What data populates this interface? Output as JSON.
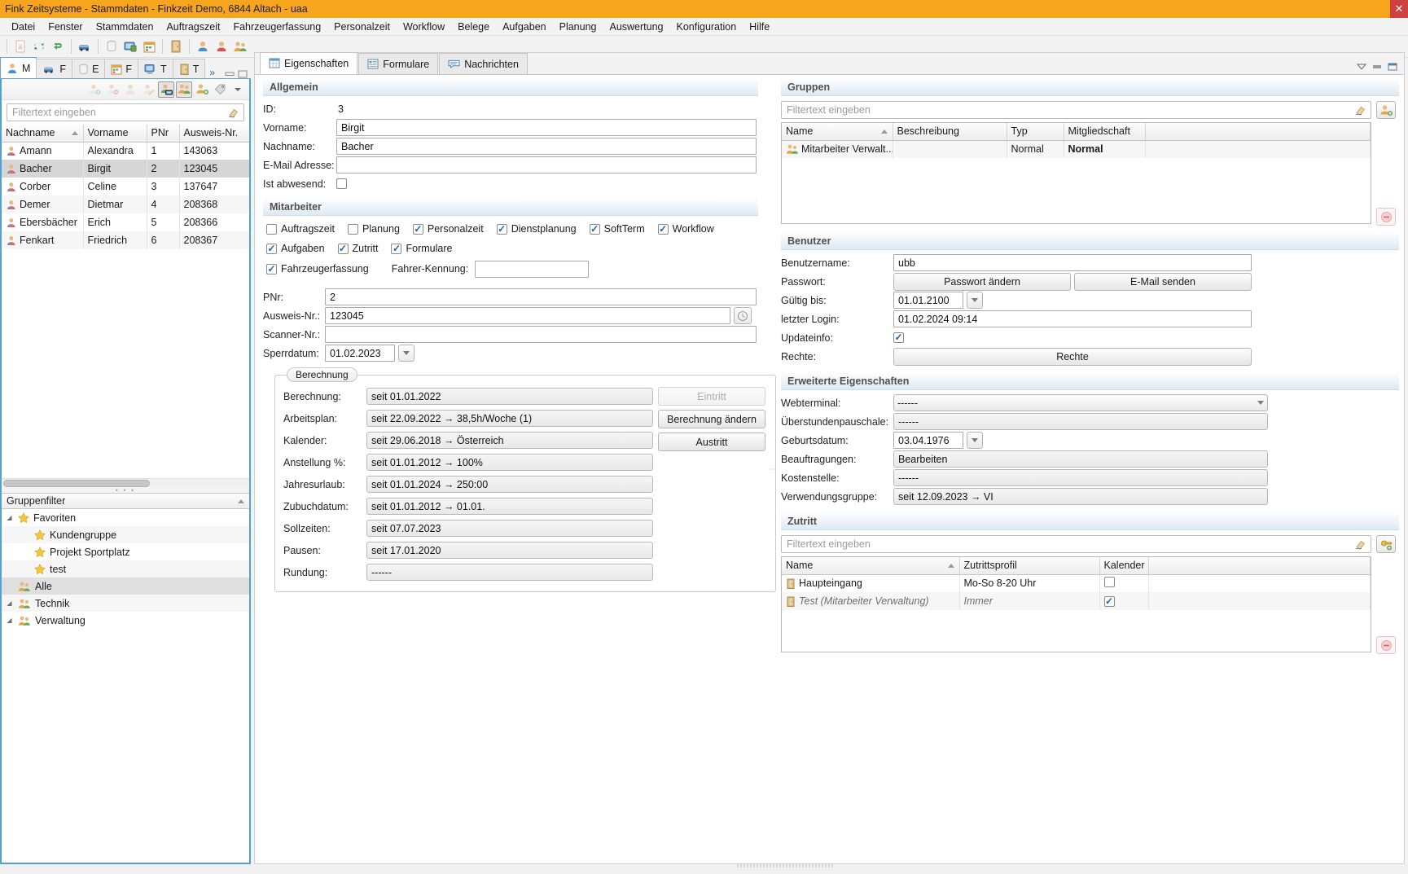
{
  "window": {
    "title": "Fink Zeitsysteme - Stammdaten - Finkzeit Demo, 6844 Altach - uaa",
    "close_label": "✕"
  },
  "menubar": {
    "items": [
      "Datei",
      "Fenster",
      "Stammdaten",
      "Auftragszeit",
      "Fahrzeugerfassung",
      "Personalzeit",
      "Workflow",
      "Belege",
      "Aufgaben",
      "Planung",
      "Auswertung",
      "Konfiguration",
      "Hilfe"
    ]
  },
  "toolbar": {
    "icons": [
      "save-icon",
      "pdf-icon",
      "refresh-icon",
      "undo-icon",
      "car-icon",
      "database-icon",
      "terminal-icon",
      "calendar-icon",
      "door-icon",
      "person-blue-icon",
      "person-red-icon",
      "person-group-icon"
    ]
  },
  "left": {
    "tabs": [
      {
        "label": "M",
        "icon": "person-blue-icon",
        "active": true
      },
      {
        "label": "F",
        "icon": "car-icon",
        "active": false
      },
      {
        "label": "E",
        "icon": "database-icon",
        "active": false
      },
      {
        "label": "F",
        "icon": "calendar-icon",
        "active": false
      },
      {
        "label": "T",
        "icon": "terminal-icon",
        "active": false
      },
      {
        "label": "T",
        "icon": "door-icon",
        "active": false
      }
    ],
    "tabs_more": "»",
    "panel_buttons": [
      {
        "name": "add-person-icon",
        "pressed": false
      },
      {
        "name": "remove-person-icon",
        "pressed": false
      },
      {
        "name": "person-red-icon",
        "pressed": false
      },
      {
        "name": "edit-person-icon",
        "pressed": false
      },
      {
        "name": "person-card-icon",
        "pressed": true
      },
      {
        "name": "person-group-green-icon",
        "pressed": true
      },
      {
        "name": "person-add-green-icon",
        "pressed": false
      },
      {
        "name": "tag-icon",
        "pressed": false
      }
    ],
    "filter_placeholder": "Filtertext eingeben",
    "filter_value": "",
    "table": {
      "columns": [
        "Nachname",
        "Vorname",
        "PNr",
        "Ausweis-Nr."
      ],
      "sorted_column": 0,
      "rows": [
        {
          "nachname": "Amann",
          "vorname": "Alexandra",
          "pnr": "1",
          "ausweis": "143063",
          "selected": false
        },
        {
          "nachname": "Bacher",
          "vorname": "Birgit",
          "pnr": "2",
          "ausweis": "123045",
          "selected": true
        },
        {
          "nachname": "Corber",
          "vorname": "Celine",
          "pnr": "3",
          "ausweis": "137647",
          "selected": false
        },
        {
          "nachname": "Demer",
          "vorname": "Dietmar",
          "pnr": "4",
          "ausweis": "208368",
          "selected": false
        },
        {
          "nachname": "Ebersbächer",
          "vorname": "Erich",
          "pnr": "5",
          "ausweis": "208366",
          "selected": false
        },
        {
          "nachname": "Fenkart",
          "vorname": "Friedrich",
          "pnr": "6",
          "ausweis": "208367",
          "selected": false
        }
      ]
    },
    "groupfilter": {
      "title": "Gruppenfilter",
      "nodes": [
        {
          "label": "Favoriten",
          "icon": "star-icon",
          "indent": 0,
          "expandable": true,
          "selected": false
        },
        {
          "label": "Kundengruppe",
          "icon": "star-icon",
          "indent": 1,
          "expandable": false,
          "selected": false
        },
        {
          "label": "Projekt Sportplatz",
          "icon": "star-icon",
          "indent": 1,
          "expandable": false,
          "selected": false
        },
        {
          "label": "test",
          "icon": "star-icon",
          "indent": 1,
          "expandable": false,
          "selected": false
        },
        {
          "label": "Alle",
          "icon": "person-group-icon",
          "indent": 0,
          "expandable": false,
          "selected": true
        },
        {
          "label": "Technik",
          "icon": "person-group-icon",
          "indent": 0,
          "expandable": true,
          "selected": false
        },
        {
          "label": "Verwaltung",
          "icon": "person-group-icon",
          "indent": 0,
          "expandable": true,
          "selected": false
        }
      ]
    }
  },
  "content": {
    "tabs": [
      {
        "label": "Eigenschaften",
        "icon": "table-icon",
        "active": true
      },
      {
        "label": "Formulare",
        "icon": "form-icon",
        "active": false
      },
      {
        "label": "Nachrichten",
        "icon": "message-icon",
        "active": false
      }
    ]
  },
  "allgemein": {
    "title": "Allgemein",
    "id_label": "ID:",
    "id_value": "3",
    "vorname_label": "Vorname:",
    "vorname_value": "Birgit",
    "nachname_label": "Nachname:",
    "nachname_value": "Bacher",
    "email_label": "E-Mail Adresse:",
    "email_value": "",
    "abwesend_label": "Ist abwesend:",
    "abwesend_checked": false
  },
  "mitarbeiter": {
    "title": "Mitarbeiter",
    "checkboxes_row1": [
      {
        "label": "Auftragszeit",
        "checked": false
      },
      {
        "label": "Planung",
        "checked": false
      },
      {
        "label": "Personalzeit",
        "checked": true
      },
      {
        "label": "Dienstplanung",
        "checked": true
      },
      {
        "label": "SoftTerm",
        "checked": true
      },
      {
        "label": "Workflow",
        "checked": true
      }
    ],
    "checkboxes_row2": [
      {
        "label": "Aufgaben",
        "checked": true
      },
      {
        "label": "Zutritt",
        "checked": true
      },
      {
        "label": "Formulare",
        "checked": true
      }
    ],
    "fahrzeug_label": "Fahrzeugerfassung",
    "fahrzeug_checked": true,
    "fahrer_label": "Fahrer-Kennung:",
    "fahrer_value": "",
    "pnr_label": "PNr:",
    "pnr_value": "2",
    "ausweis_label": "Ausweis-Nr.:",
    "ausweis_value": "123045",
    "scanner_label": "Scanner-Nr.:",
    "scanner_value": "",
    "sperrdatum_label": "Sperrdatum:",
    "sperrdatum_value": "01.02.2023"
  },
  "berechnung": {
    "legend": "Berechnung",
    "rows": [
      {
        "label": "Berechnung:",
        "value": "seit 01.01.2022"
      },
      {
        "label": "Arbeitsplan:",
        "value": "seit 22.09.2022 → 38,5h/Woche (1)"
      },
      {
        "label": "Kalender:",
        "value": "seit 29.06.2018 → Österreich"
      },
      {
        "label": "Anstellung %:",
        "value": "seit 01.01.2012 → 100%"
      },
      {
        "label": "Jahresurlaub:",
        "value": "seit 01.01.2024 → 250:00"
      },
      {
        "label": "Zubuchdatum:",
        "value": "seit 01.01.2012 → 01.01."
      },
      {
        "label": "Sollzeiten:",
        "value": "seit 07.07.2023"
      },
      {
        "label": "Pausen:",
        "value": "seit 17.01.2020"
      },
      {
        "label": "Rundung:",
        "value": "------"
      }
    ],
    "buttons": [
      {
        "label": "Eintritt",
        "disabled": true
      },
      {
        "label": "Berechnung ändern",
        "disabled": false
      },
      {
        "label": "Austritt",
        "disabled": false
      }
    ]
  },
  "gruppen": {
    "title": "Gruppen",
    "filter_placeholder": "Filtertext eingeben",
    "filter_value": "",
    "columns": [
      "Name",
      "Beschreibung",
      "Typ",
      "Mitgliedschaft",
      ""
    ],
    "sorted_column": 0,
    "rows": [
      {
        "name": "Mitarbeiter Verwalt...",
        "beschreibung": "",
        "typ": "Normal",
        "mitgliedschaft": "Normal",
        "extra": ""
      }
    ],
    "add_button": "person-group-add-icon",
    "remove_button": "minus-icon"
  },
  "benutzer": {
    "title": "Benutzer",
    "benutzername_label": "Benutzername:",
    "benutzername_value": "ubb",
    "passwort_label": "Passwort:",
    "passwort_change_button": "Passwort ändern",
    "email_send_button": "E-Mail senden",
    "gueltig_label": "Gültig bis:",
    "gueltig_value": "01.01.2100",
    "login_label": "letzter Login:",
    "login_value": "01.02.2024 09:14",
    "updateinfo_label": "Updateinfo:",
    "updateinfo_checked": true,
    "rechte_label": "Rechte:",
    "rechte_button": "Rechte"
  },
  "erweitert": {
    "title": "Erweiterte Eigenschaften",
    "rows": [
      {
        "label": "Webterminal:",
        "value": "------",
        "type": "combo"
      },
      {
        "label": "Überstundenpauschale:",
        "value": "------",
        "type": "ro"
      },
      {
        "label": "Geburtsdatum:",
        "value": "03.04.1976",
        "type": "date"
      },
      {
        "label": "Beauftragungen:",
        "value": "Bearbeiten",
        "type": "ro"
      },
      {
        "label": "Kostenstelle:",
        "value": "------",
        "type": "ro"
      },
      {
        "label": "Verwendungsgruppe:",
        "value": "seit 12.09.2023 → VI",
        "type": "ro"
      }
    ]
  },
  "zutritt": {
    "title": "Zutritt",
    "filter_placeholder": "Filtertext eingeben",
    "filter_value": "",
    "columns": [
      "Name",
      "Zutrittsprofil",
      "Kalender",
      ""
    ],
    "sorted_column": 0,
    "rows": [
      {
        "name": "Haupteingang",
        "profil": "Mo-So 8-20 Uhr",
        "kalender": false,
        "italic": false
      },
      {
        "name": "Test (Mitarbeiter Verwaltung)",
        "profil": "Immer",
        "kalender": true,
        "italic": true
      }
    ],
    "add_button": "key-add-icon",
    "remove_button": "minus-icon"
  },
  "colors": {
    "title_bar": "#f7a51c",
    "accent_border": "#56a0cc",
    "section_gradient": "#ddeaf4",
    "check_blue": "#1a62b8"
  }
}
